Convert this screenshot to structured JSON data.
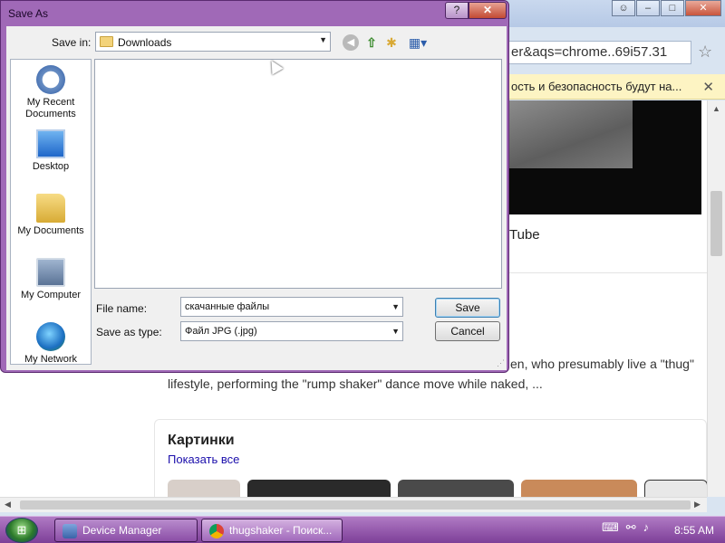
{
  "browser": {
    "url_fragment": "er&aqs=chrome..69i57.31",
    "infobar_text": "ость и безопасность будут на...",
    "video_caption": "Tube",
    "snippet_line1": "en, who presumably live a \"thug\"",
    "snippet_line2": "lifestyle, performing the \"rump shaker\" dance move while naked, ...",
    "images_title": "Картинки",
    "images_link": "Показать все"
  },
  "dialog": {
    "title": "Save As",
    "help_label": "?",
    "close_label": "✕",
    "save_in_label": "Save in:",
    "save_in_value": "Downloads",
    "places": [
      {
        "label": "My Recent Documents",
        "icon": "recent-documents-icon"
      },
      {
        "label": "Desktop",
        "icon": "desktop-icon"
      },
      {
        "label": "My Documents",
        "icon": "my-documents-icon"
      },
      {
        "label": "My Computer",
        "icon": "my-computer-icon"
      },
      {
        "label": "My Network",
        "icon": "my-network-icon"
      }
    ],
    "file_name_label": "File name:",
    "file_name_value": "скачанные файлы",
    "save_as_type_label": "Save as type:",
    "save_as_type_value": "Файл JPG (.jpg)",
    "save_button": "Save",
    "cancel_button": "Cancel"
  },
  "taskbar": {
    "start_label": "",
    "tasks": [
      {
        "label": "Device Manager",
        "icon": "device-manager-icon"
      },
      {
        "label": "thugshaker - Поиск...",
        "icon": "chrome-icon"
      }
    ],
    "clock": "8:55 AM"
  },
  "colors": {
    "dialog_frame": "#a069b7",
    "taskbar": "#7d3f98",
    "link": "#1a0dab",
    "infobar": "#fdf4c3"
  }
}
